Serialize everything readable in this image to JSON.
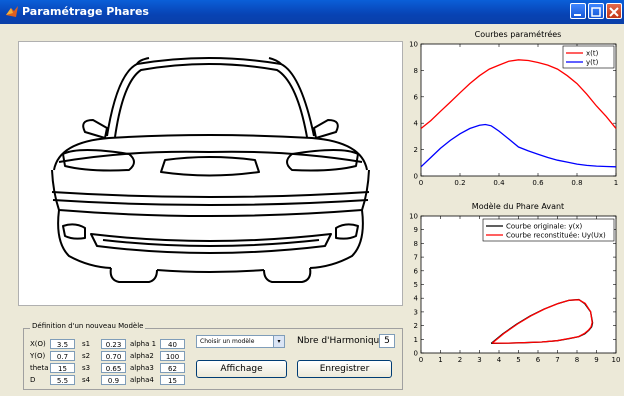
{
  "window": {
    "title": "Paramétrage Phares"
  },
  "fieldset": {
    "legend": "Définition d'un nouveau Modèle",
    "col1_labels": [
      "X(O)",
      "Y(O)",
      "theta",
      "D"
    ],
    "col1_values": [
      "3.5",
      "0.7",
      "15",
      "5.5"
    ],
    "col2_labels": [
      "s1",
      "s2",
      "s3",
      "s4"
    ],
    "col2_values": [
      "0.23",
      "0.70",
      "0.65",
      "0.9"
    ],
    "col3_labels": [
      "alpha 1",
      "alpha2",
      "alpha3",
      "alpha4"
    ],
    "col3_values": [
      "40",
      "100",
      "62",
      "15"
    ]
  },
  "model_select": {
    "value": "Choisir un modèle"
  },
  "harmonics": {
    "label": "Nbre d'Harmoniques:",
    "value": "5"
  },
  "buttons": {
    "display": "Affichage",
    "save": "Enregistrer"
  },
  "chart_data": [
    {
      "type": "line",
      "title": "Courbes paramétrées",
      "xlim": [
        0,
        1
      ],
      "ylim": [
        0,
        10
      ],
      "xticks": [
        "0",
        "0.2",
        "0.4",
        "0.6",
        "0.8",
        "1"
      ],
      "yticks": [
        "0",
        "2",
        "4",
        "6",
        "8",
        "10"
      ],
      "legend_position": "top-right",
      "series": [
        {
          "name": "x(t)",
          "color": "#ff0000",
          "x": [
            0,
            0.05,
            0.1,
            0.15,
            0.2,
            0.25,
            0.3,
            0.35,
            0.4,
            0.45,
            0.5,
            0.55,
            0.6,
            0.65,
            0.7,
            0.75,
            0.8,
            0.85,
            0.9,
            0.95,
            1.0
          ],
          "y": [
            3.6,
            4.2,
            4.9,
            5.6,
            6.3,
            7.0,
            7.6,
            8.1,
            8.4,
            8.7,
            8.8,
            8.75,
            8.6,
            8.4,
            8.1,
            7.6,
            7.0,
            6.2,
            5.3,
            4.5,
            3.6
          ]
        },
        {
          "name": "y(t)",
          "color": "#0000ff",
          "x": [
            0,
            0.05,
            0.1,
            0.15,
            0.2,
            0.25,
            0.3,
            0.33,
            0.36,
            0.4,
            0.45,
            0.5,
            0.55,
            0.6,
            0.65,
            0.7,
            0.75,
            0.8,
            0.85,
            0.9,
            0.95,
            1.0
          ],
          "y": [
            0.7,
            1.4,
            2.1,
            2.7,
            3.2,
            3.6,
            3.85,
            3.9,
            3.8,
            3.4,
            2.8,
            2.2,
            1.9,
            1.65,
            1.4,
            1.2,
            1.05,
            0.9,
            0.8,
            0.75,
            0.72,
            0.7
          ]
        }
      ]
    },
    {
      "type": "line",
      "title": "Modèle du Phare Avant",
      "xlim": [
        0,
        10
      ],
      "ylim": [
        0,
        10
      ],
      "xticks": [
        "0",
        "1",
        "2",
        "3",
        "4",
        "5",
        "6",
        "7",
        "8",
        "9",
        "10"
      ],
      "yticks": [
        "0",
        "1",
        "2",
        "3",
        "4",
        "5",
        "6",
        "7",
        "8",
        "9",
        "10"
      ],
      "legend_position": "top-right",
      "series": [
        {
          "name": "Courbe originale: y(x)",
          "color": "#000000",
          "x": [
            3.6,
            4.2,
            4.9,
            5.6,
            6.3,
            7.0,
            7.6,
            8.1,
            8.4,
            8.7,
            8.8,
            8.75,
            8.6,
            8.4,
            8.1,
            7.6,
            7.0,
            6.2,
            5.3,
            4.5,
            3.6
          ],
          "y": [
            0.7,
            1.4,
            2.1,
            2.7,
            3.2,
            3.6,
            3.85,
            3.9,
            3.6,
            3.0,
            2.2,
            1.9,
            1.65,
            1.4,
            1.2,
            1.05,
            0.9,
            0.8,
            0.75,
            0.72,
            0.7
          ]
        },
        {
          "name": "Courbe reconstituée: Uy(Ux)",
          "color": "#ff0000",
          "x": [
            3.65,
            4.25,
            4.95,
            5.65,
            6.35,
            7.05,
            7.62,
            8.1,
            8.42,
            8.7,
            8.78,
            8.72,
            8.58,
            8.38,
            8.08,
            7.58,
            6.98,
            6.18,
            5.28,
            4.48,
            3.65
          ],
          "y": [
            0.72,
            1.42,
            2.12,
            2.72,
            3.22,
            3.62,
            3.86,
            3.88,
            3.62,
            3.02,
            2.22,
            1.9,
            1.66,
            1.42,
            1.2,
            1.06,
            0.9,
            0.8,
            0.76,
            0.72,
            0.72
          ]
        }
      ]
    }
  ]
}
